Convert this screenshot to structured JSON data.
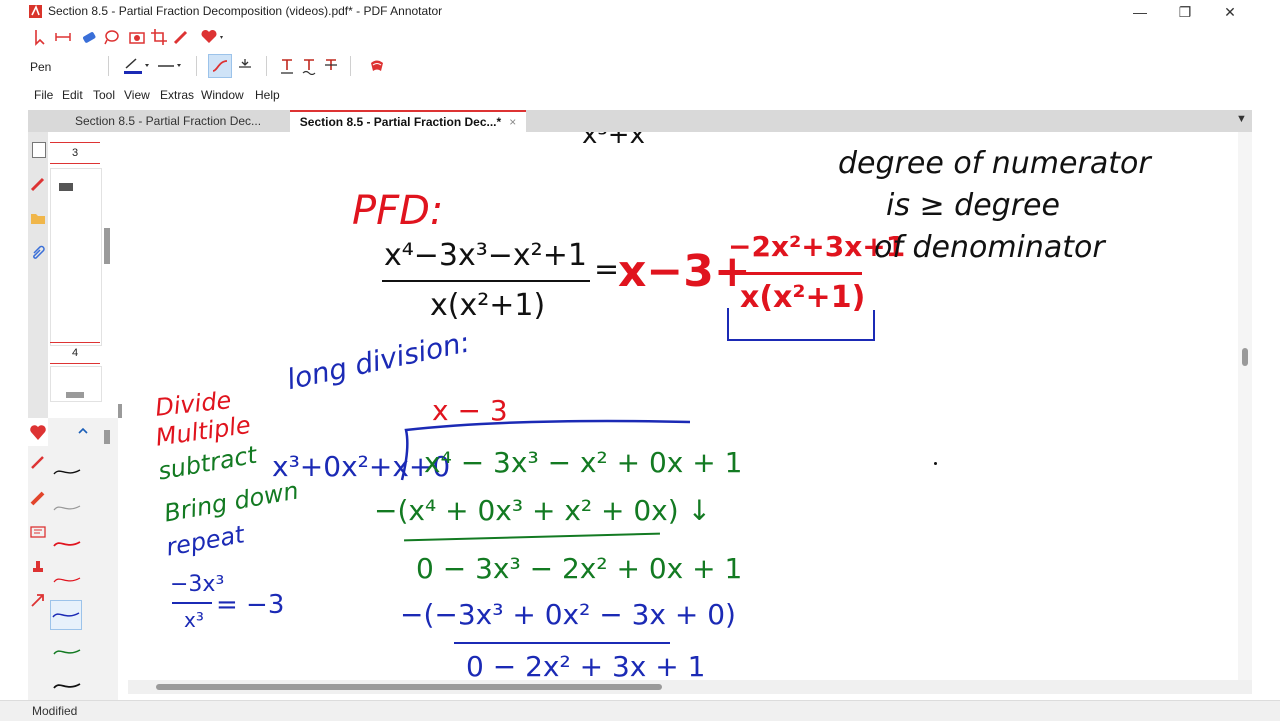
{
  "window": {
    "title": "Section 8.5 - Partial Fraction Decomposition (videos).pdf* - PDF Annotator",
    "min_glyph": "—",
    "max_glyph": "❐",
    "close_glyph": "✕"
  },
  "toolbar": {
    "current_tool_label": "Pen",
    "icons": [
      "select-icon",
      "page-fit-icon",
      "eraser-icon",
      "lasso-icon",
      "camera-icon",
      "crop-icon",
      "pen-icon",
      "favorites-icon"
    ]
  },
  "menu": {
    "items": [
      "File",
      "Edit",
      "Tool",
      "View",
      "Extras",
      "Window",
      "Help"
    ]
  },
  "tabs": [
    {
      "label": "Section 8.5 - Partial Fraction Dec...",
      "active": false
    },
    {
      "label": "Section 8.5 - Partial Fraction Dec...*",
      "active": true
    }
  ],
  "tab_close_glyph": "×",
  "tab_menu_glyph": "▼",
  "thumbnails": {
    "pages": [
      "3",
      "4"
    ]
  },
  "document": {
    "pfd_label": "PFD:",
    "lhs_numerator": "x⁴−3x³−x²+1",
    "lhs_denominator": "x(x²+1)",
    "equals": "=",
    "quotient": "x−3+",
    "remainder_numerator": "−2x²+3x+1",
    "remainder_denominator": "x(x²+1)",
    "top_fragment": "x³+x",
    "note_line1": "degree of numerator",
    "note_line2": "is ≥ degree",
    "note_line3": "of denominator",
    "long_division_label": "long division:",
    "steps": [
      "Divide",
      "Multiple",
      "subtract",
      "Bring down",
      "repeat"
    ],
    "side_calc_num": "−3x³",
    "side_calc_den": "x³",
    "side_calc_result": "= −3",
    "ld_quotient": "x − 3",
    "ld_divisor": "x³+0x²+x+0",
    "ld_dividend": "x⁴ − 3x³ − x² + 0x + 1",
    "ld_sub1": "−(x⁴ + 0x³ + x² + 0x) ↓",
    "ld_row2": "0 − 3x³ − 2x² + 0x + 1",
    "ld_sub2": "−(−3x³ + 0x² − 3x + 0)",
    "ld_row3": "0 − 2x² + 3x + 1"
  },
  "status": {
    "text": "Modified"
  },
  "colors": {
    "red_ink": "#e0141e",
    "blue_ink": "#1b2ab5",
    "green_ink": "#137a22",
    "black_ink": "#111111",
    "accent": "#d33b2c"
  }
}
